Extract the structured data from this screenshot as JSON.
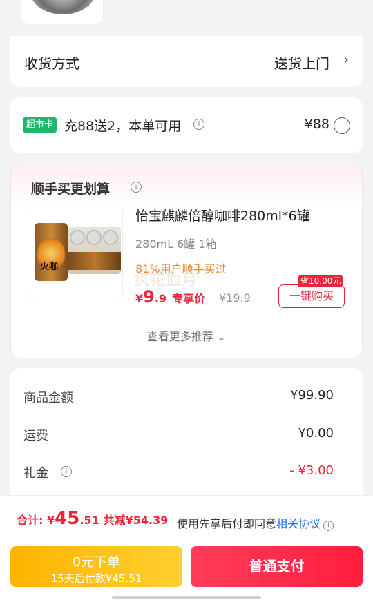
{
  "delivery": {
    "label": "收货方式",
    "value": "送货上门",
    "chevron": "›"
  },
  "supermarket_card": {
    "badge": "超市卡",
    "text": "充88送2，本单可用",
    "info_icon": "ⓘ",
    "price": "¥88"
  },
  "recommend": {
    "title": "顺手买更划算",
    "product": {
      "name": "怡宝麒麟倍醇咖啡280ml*6罐",
      "spec": "280mL 6罐 1箱",
      "tag": "81%用户顺手买过",
      "watermark": "疯花血月",
      "price_symbol": "¥",
      "price_int": "9",
      "price_dec": ".9",
      "price_label": "专享价",
      "original_price": "¥19.9",
      "save_tag": "省10.00元",
      "buy_button": "一键购买",
      "can_text": "火咖"
    },
    "more": "查看更多推荐 ⌄"
  },
  "amounts": {
    "rows": [
      {
        "label": "商品金额",
        "value": "¥99.90"
      },
      {
        "label": "运费",
        "value": "¥0.00"
      },
      {
        "label": "礼金",
        "value": "- ¥3.00"
      }
    ]
  },
  "bottom": {
    "total_label": "合计:",
    "total_symbol": "¥",
    "total_int": "45",
    "total_dec": ".51",
    "total_save": "共减¥54.39",
    "agree_text": "使用先享后付即同意",
    "agree_link": "相关协议",
    "pay_later_line1": "0元下单",
    "pay_later_line2": "15天后付款¥45.51",
    "pay_button": "普通支付"
  },
  "colors": {
    "accent_red": "#e8253a",
    "badge_green": "#1fb86b",
    "pay_later_yellow": "#ffb400",
    "link_blue": "#1f6fe0"
  }
}
